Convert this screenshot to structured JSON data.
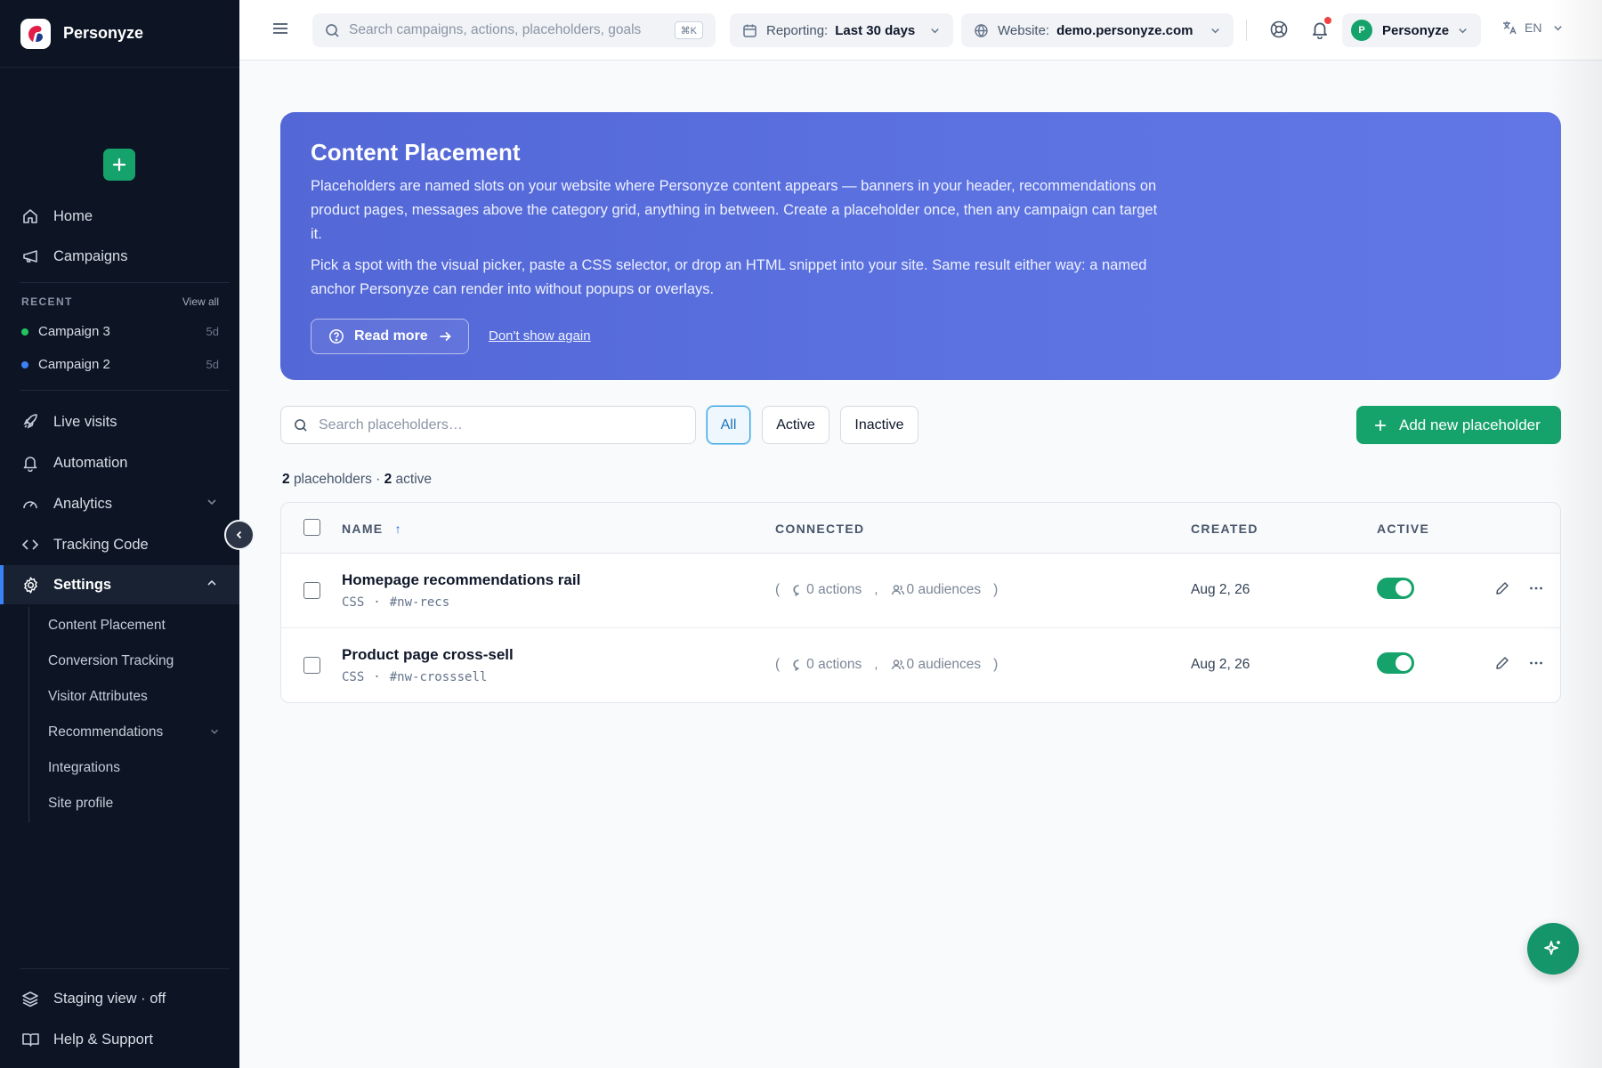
{
  "brand": {
    "name": "Personyze"
  },
  "sidebar": {
    "create_label": "+",
    "nav_top": [
      {
        "label": "Home",
        "icon": "home-icon"
      },
      {
        "label": "Campaigns",
        "icon": "megaphone-icon"
      }
    ],
    "recent": {
      "title": "RECENT",
      "view_all": "View all",
      "items": [
        {
          "label": "Campaign 3",
          "age": "5d",
          "color": "#22c55e"
        },
        {
          "label": "Campaign 2",
          "age": "5d",
          "color": "#3b82f6"
        }
      ]
    },
    "nav_main": [
      {
        "label": "Live visits",
        "icon": "rocket-icon"
      },
      {
        "label": "Automation",
        "icon": "bell-icon"
      },
      {
        "label": "Analytics",
        "icon": "gauge-icon"
      },
      {
        "label": "Tracking Code",
        "icon": "code-icon"
      },
      {
        "label": "Settings",
        "icon": "gear-icon"
      }
    ],
    "settings_sub": [
      {
        "label": "Content Placement"
      },
      {
        "label": "Conversion Tracking"
      },
      {
        "label": "Visitor Attributes"
      },
      {
        "label": "Recommendations"
      },
      {
        "label": "Integrations"
      },
      {
        "label": "Site profile"
      }
    ],
    "footer": [
      {
        "label": "Staging view · off",
        "icon": "layers-icon"
      },
      {
        "label": "Help & Support",
        "icon": "book-icon"
      }
    ]
  },
  "topbar": {
    "search_placeholder": "Search campaigns, actions, placeholders, goals",
    "search_shortcut": "⌘K",
    "reporting_label": "Reporting:",
    "reporting_value": "Last 30 days",
    "website_label": "Website:",
    "website_value": "demo.personyze.com",
    "account_initial": "P",
    "account_name": "Personyze",
    "language": "EN"
  },
  "banner": {
    "title": "Content Placement",
    "paragraph1": "Placeholders are named slots on your website where Personyze content appears — banners in your header, recommendations on product pages, messages above the category grid, anything in between. Create a placeholder once, then any campaign can target it.",
    "paragraph2": "Pick a spot with the visual picker, paste a CSS selector, or drop an HTML snippet into your site. Same result either way: a named anchor Personyze can render into without popups or overlays.",
    "read_more": "Read more",
    "dont_show": "Don't show again"
  },
  "toolbar": {
    "search_placeholder": "Search placeholders…",
    "filters": [
      "All",
      "Active",
      "Inactive"
    ],
    "selected_filter": "All",
    "add_label": "Add new placeholder"
  },
  "summary": {
    "total": "2",
    "total_label": "placeholders ·",
    "active": "2",
    "active_label": "active"
  },
  "table": {
    "columns": {
      "name": "NAME",
      "sort_arrow": "↑",
      "connected": "CONNECTED",
      "created": "CREATED",
      "active": "ACTIVE"
    },
    "rows": [
      {
        "name": "Homepage recommendations rail",
        "type": "CSS",
        "selector": "#nw-recs",
        "actions": "0 actions",
        "audiences": "0 audiences",
        "created": "Aug 2, 26",
        "active": true
      },
      {
        "name": "Product page cross-sell",
        "type": "CSS",
        "selector": "#nw-crosssell",
        "actions": "0 actions",
        "audiences": "0 audiences",
        "created": "Aug 2, 26",
        "active": true
      }
    ]
  },
  "colors": {
    "accent_green": "#16a36b",
    "banner_blue": "#5a6fdd",
    "sidebar_bg": "#0d1524"
  }
}
